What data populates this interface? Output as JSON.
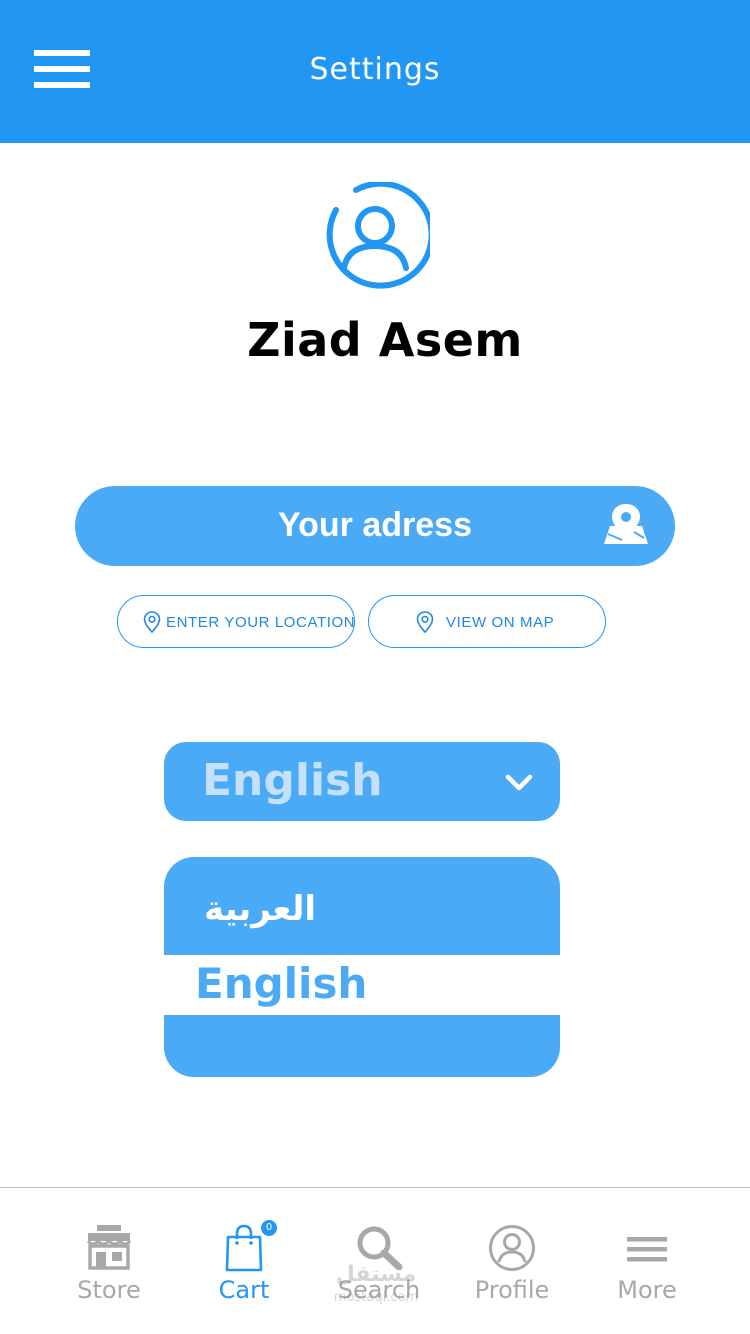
{
  "header": {
    "title": "Settings",
    "background_color": "#2196f3"
  },
  "profile": {
    "name": "Ziad Asem",
    "avatar_icon": "user-circle-icon"
  },
  "address": {
    "label": "Your adress",
    "icon": "map-pin-icon",
    "enter_location_label": "ENTER YOUR LOCATION",
    "view_on_map_label": "VIEW ON MAP"
  },
  "language": {
    "selected": "English",
    "options": [
      "العربية",
      "English"
    ],
    "highlighted_option": "English"
  },
  "tabbar": {
    "items": [
      {
        "label": "Store",
        "icon": "store-icon"
      },
      {
        "label": "Cart",
        "icon": "shopping-bag-icon",
        "badge": "0"
      },
      {
        "label": "Search",
        "icon": "search-icon"
      },
      {
        "label": "Profile",
        "icon": "user-circle-icon"
      },
      {
        "label": "More",
        "icon": "menu-icon"
      }
    ],
    "active": "Cart"
  },
  "watermark": {
    "arabic": "مستقل",
    "latin": "mostaql.com"
  },
  "colors": {
    "primary": "#2196f3",
    "accent_light": "#4aaaf5",
    "inactive": "#a8a8a8"
  }
}
